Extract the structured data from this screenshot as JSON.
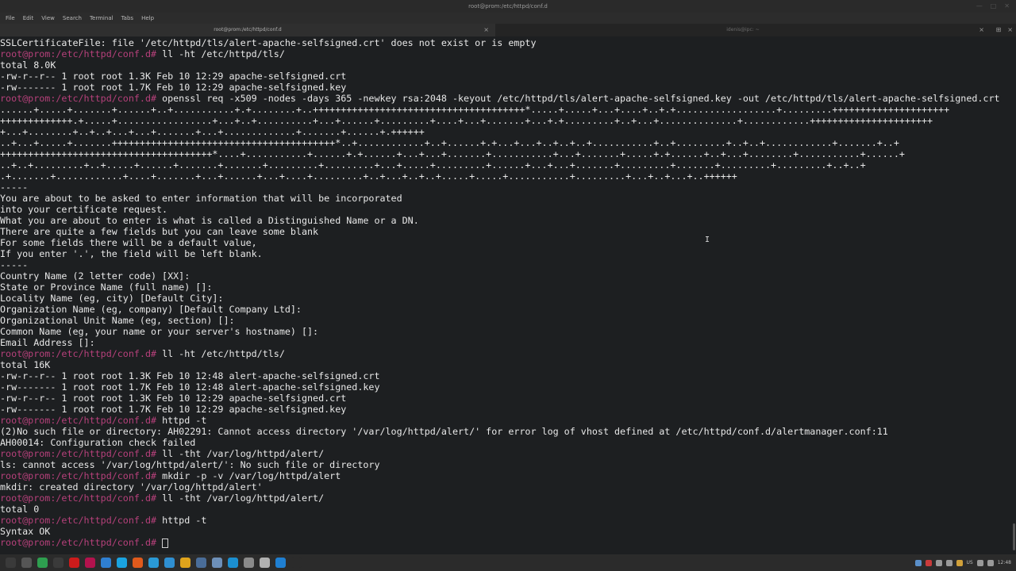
{
  "window": {
    "title": "root@prom:/etc/httpd/conf.d"
  },
  "menu": [
    "File",
    "Edit",
    "View",
    "Search",
    "Terminal",
    "Tabs",
    "Help"
  ],
  "tabs": [
    {
      "label": "root@prom:/etc/httpd/conf.d",
      "active": true
    },
    {
      "label": "idenis@ipc: ~",
      "active": false
    }
  ],
  "terminal": {
    "lines": [
      {
        "text": "SSLCertificateFile: file '/etc/httpd/tls/alert-apache-selfsigned.crt' does not exist or is empty"
      },
      {
        "prompt": "root@prom:/etc/httpd/conf.d# ",
        "text": "ll -ht /etc/httpd/tls/"
      },
      {
        "text": "total 8.0K"
      },
      {
        "text": "-rw-r--r-- 1 root root 1.3K Feb 10 12:29 apache-selfsigned.crt"
      },
      {
        "text": "-rw------- 1 root root 1.7K Feb 10 12:29 apache-selfsigned.key"
      },
      {
        "prompt": "root@prom:/etc/httpd/conf.d# ",
        "text": "openssl req -x509 -nodes -days 365 -newkey rsa:2048 -keyout /etc/httpd/tls/alert-apache-selfsigned.key -out /etc/httpd/tls/alert-apache-selfsigned.crt"
      },
      {
        "text": "......+.....+.......+......+..+...........+.+........+..++++++++++++++++++++++++++++++++++++++*.....+.....+...+....+..+.+..................+.........+++++++++++++++++++++"
      },
      {
        "text": "+++++++++++++.+.....+.................+...+..+..........+...+......+.........+....+...+.......+...+.+.........+..+...+..............+............++++++++++++++++++++++"
      },
      {
        "text": "+...+........+..+..+...+...+.......+...+.............+.......+......+.++++++"
      },
      {
        "text": "..+...+.....+.......++++++++++++++++++++++++++++++++++++++++*..+............+..+......+.+...+...+..+..+..+...........+..+.........+..+..+............+.......+..+"
      },
      {
        "text": "++++++++++++++++++++++++++++++++++++++*....+...........+......+.+......+...+...+.......+...........+...+.......+.....+.+......+..+...+........+...........+......+"
      },
      {
        "text": "..+..+.........+..+.....+......+.......+.......+.........+.........+...+.....+.........+......+...+...+.......+.........+.......+.........+.........+..+..+"
      },
      {
        "text": ".+.......+............+....+.......+...+......+...+....+.........+..+...+..+..+.....+.....+...........+.........+...+..+...+..++++++"
      },
      {
        "text": "-----"
      },
      {
        "text": "You are about to be asked to enter information that will be incorporated"
      },
      {
        "text": "into your certificate request."
      },
      {
        "text": "What you are about to enter is what is called a Distinguished Name or a DN."
      },
      {
        "text": "There are quite a few fields but you can leave some blank"
      },
      {
        "text": "For some fields there will be a default value,"
      },
      {
        "text": "If you enter '.', the field will be left blank."
      },
      {
        "text": "-----"
      },
      {
        "text": "Country Name (2 letter code) [XX]:"
      },
      {
        "text": "State or Province Name (full name) []:"
      },
      {
        "text": "Locality Name (eg, city) [Default City]:"
      },
      {
        "text": "Organization Name (eg, company) [Default Company Ltd]:"
      },
      {
        "text": "Organizational Unit Name (eg, section) []:"
      },
      {
        "text": "Common Name (eg, your name or your server's hostname) []:"
      },
      {
        "text": "Email Address []:"
      },
      {
        "prompt": "root@prom:/etc/httpd/conf.d# ",
        "text": "ll -ht /etc/httpd/tls/"
      },
      {
        "text": "total 16K"
      },
      {
        "text": "-rw-r--r-- 1 root root 1.3K Feb 10 12:48 alert-apache-selfsigned.crt"
      },
      {
        "text": "-rw------- 1 root root 1.7K Feb 10 12:48 alert-apache-selfsigned.key"
      },
      {
        "text": "-rw-r--r-- 1 root root 1.3K Feb 10 12:29 apache-selfsigned.crt"
      },
      {
        "text": "-rw------- 1 root root 1.7K Feb 10 12:29 apache-selfsigned.key"
      },
      {
        "prompt": "root@prom:/etc/httpd/conf.d# ",
        "text": "httpd -t"
      },
      {
        "text": "(2)No such file or directory: AH02291: Cannot access directory '/var/log/httpd/alert/' for error log of vhost defined at /etc/httpd/conf.d/alertmanager.conf:11"
      },
      {
        "text": "AH00014: Configuration check failed"
      },
      {
        "prompt": "root@prom:/etc/httpd/conf.d# ",
        "text": "ll -tht /var/log/httpd/alert/"
      },
      {
        "text": "ls: cannot access '/var/log/httpd/alert/': No such file or directory"
      },
      {
        "prompt": "root@prom:/etc/httpd/conf.d# ",
        "text": "mkdir -p -v /var/log/httpd/alert"
      },
      {
        "text": "mkdir: created directory '/var/log/httpd/alert'"
      },
      {
        "prompt": "root@prom:/etc/httpd/conf.d# ",
        "text": "ll -tht /var/log/httpd/alert/"
      },
      {
        "text": "total 0"
      },
      {
        "prompt": "root@prom:/etc/httpd/conf.d# ",
        "text": "httpd -t"
      },
      {
        "text": "Syntax OK"
      },
      {
        "prompt": "root@prom:/etc/httpd/conf.d# ",
        "text": "",
        "cursor": true
      }
    ]
  },
  "taskbar": {
    "apps": [
      {
        "icon": "menu-icon",
        "color": "#3a3a3a"
      },
      {
        "icon": "app-icon",
        "color": "#555555"
      },
      {
        "icon": "app-icon",
        "color": "#2e9e4f"
      },
      {
        "icon": "app-icon",
        "color": "#3a3a3a"
      },
      {
        "icon": "opera-icon",
        "color": "#cc1b1b"
      },
      {
        "icon": "raspberry-icon",
        "color": "#b3124d"
      },
      {
        "icon": "app-icon",
        "color": "#2f7fd1"
      },
      {
        "icon": "skype-icon",
        "color": "#1aa3e0"
      },
      {
        "icon": "app-icon",
        "color": "#e05a1c"
      },
      {
        "icon": "telegram-icon",
        "color": "#2a9ad6"
      },
      {
        "icon": "app-icon",
        "color": "#2f8fd1"
      },
      {
        "icon": "chrome-icon",
        "color": "#e0a41c"
      },
      {
        "icon": "monitor-icon",
        "color": "#4a6d99"
      },
      {
        "icon": "folder-icon",
        "color": "#6d8fb8"
      },
      {
        "icon": "edge-icon",
        "color": "#1b8fd0"
      },
      {
        "icon": "app-icon",
        "color": "#8a8a8a"
      },
      {
        "icon": "app-icon",
        "color": "#b0b0b0"
      },
      {
        "icon": "vscode-icon",
        "color": "#1f7fd1"
      },
      {
        "icon": "terminal-icon",
        "color": "#2b2b2b"
      }
    ],
    "tray": {
      "locale": "US",
      "clock": "12:48"
    }
  },
  "colors": {
    "background": "#1d1f21",
    "text": "#e8e8e8",
    "prompt": "#b5407a"
  }
}
